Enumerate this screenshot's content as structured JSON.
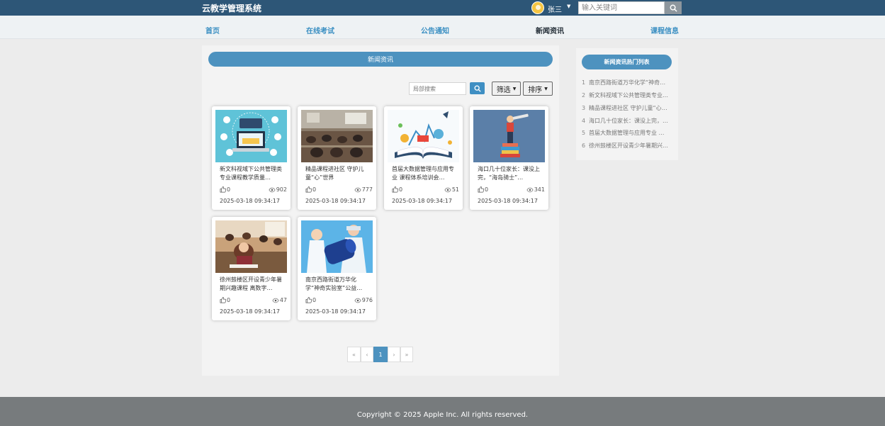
{
  "header": {
    "brand": "云教学管理系统",
    "username": "张三",
    "search_placeholder": "输入关键词"
  },
  "nav": [
    {
      "label": "首页",
      "active": false
    },
    {
      "label": "在线考试",
      "active": false
    },
    {
      "label": "公告通知",
      "active": false
    },
    {
      "label": "新闻资讯",
      "active": true
    },
    {
      "label": "课程信息",
      "active": false
    }
  ],
  "main": {
    "section_title": "新闻资讯",
    "local_search_placeholder": "局部搜索",
    "filter_label": "筛选",
    "sort_label": "排序"
  },
  "cards": [
    {
      "title": "新文科视域下公共管理类专业课程教学质量…",
      "likes": "0",
      "views": "902",
      "date": "2025-03-18 09:34:17",
      "image": "online-education-laptop"
    },
    {
      "title": "精品课程进社区 守护儿童“心”世界",
      "likes": "0",
      "views": "777",
      "date": "2025-03-18 09:34:17",
      "image": "classroom-students"
    },
    {
      "title": "首届大数据管理与应用专业 课程体系培训会…",
      "likes": "0",
      "views": "51",
      "date": "2025-03-18 09:34:17",
      "image": "open-book-rocket"
    },
    {
      "title": "海口几十位家长：课没上完，“海岛骑士”…",
      "likes": "0",
      "views": "341",
      "date": "2025-03-18 09:34:17",
      "image": "man-telescope-books"
    },
    {
      "title": "徐州鼓楼区开设青少年暑期兴趣课程 离数字…",
      "likes": "0",
      "views": "47",
      "date": "2025-03-18 09:34:17",
      "image": "students-exam-hall"
    },
    {
      "title": "南京西路街道万华化学“神奇实验室”公益…",
      "likes": "0",
      "views": "976",
      "date": "2025-03-18 09:34:17",
      "image": "science-lab-kids"
    }
  ],
  "pagination": {
    "first": "«",
    "prev": "‹",
    "current": "1",
    "next": "›",
    "last": "»"
  },
  "sidebar": {
    "title": "新闻资讯热门列表",
    "items": [
      {
        "num": "1",
        "text": "南京西路街道万华化学“神奇实验室”公益…"
      },
      {
        "num": "2",
        "text": "新文科视域下公共管理类专业课程教学质量…"
      },
      {
        "num": "3",
        "text": "精品课程进社区 守护儿童“心”世界"
      },
      {
        "num": "4",
        "text": "海口几十位家长：课没上完，“海岛骑士”…"
      },
      {
        "num": "5",
        "text": "首届大数据管理与应用专业 课程体系培训会…"
      },
      {
        "num": "6",
        "text": "徐州鼓楼区开设青少年暑期兴趣课程 离数字…"
      }
    ]
  },
  "footer": {
    "copyright": "Copyright © 2025 Apple Inc. All rights reserved."
  },
  "colors": {
    "topbar": "#2d5677",
    "accent": "#4d92bf",
    "nav_link": "#3a8fc2",
    "footer": "#777b7d"
  }
}
